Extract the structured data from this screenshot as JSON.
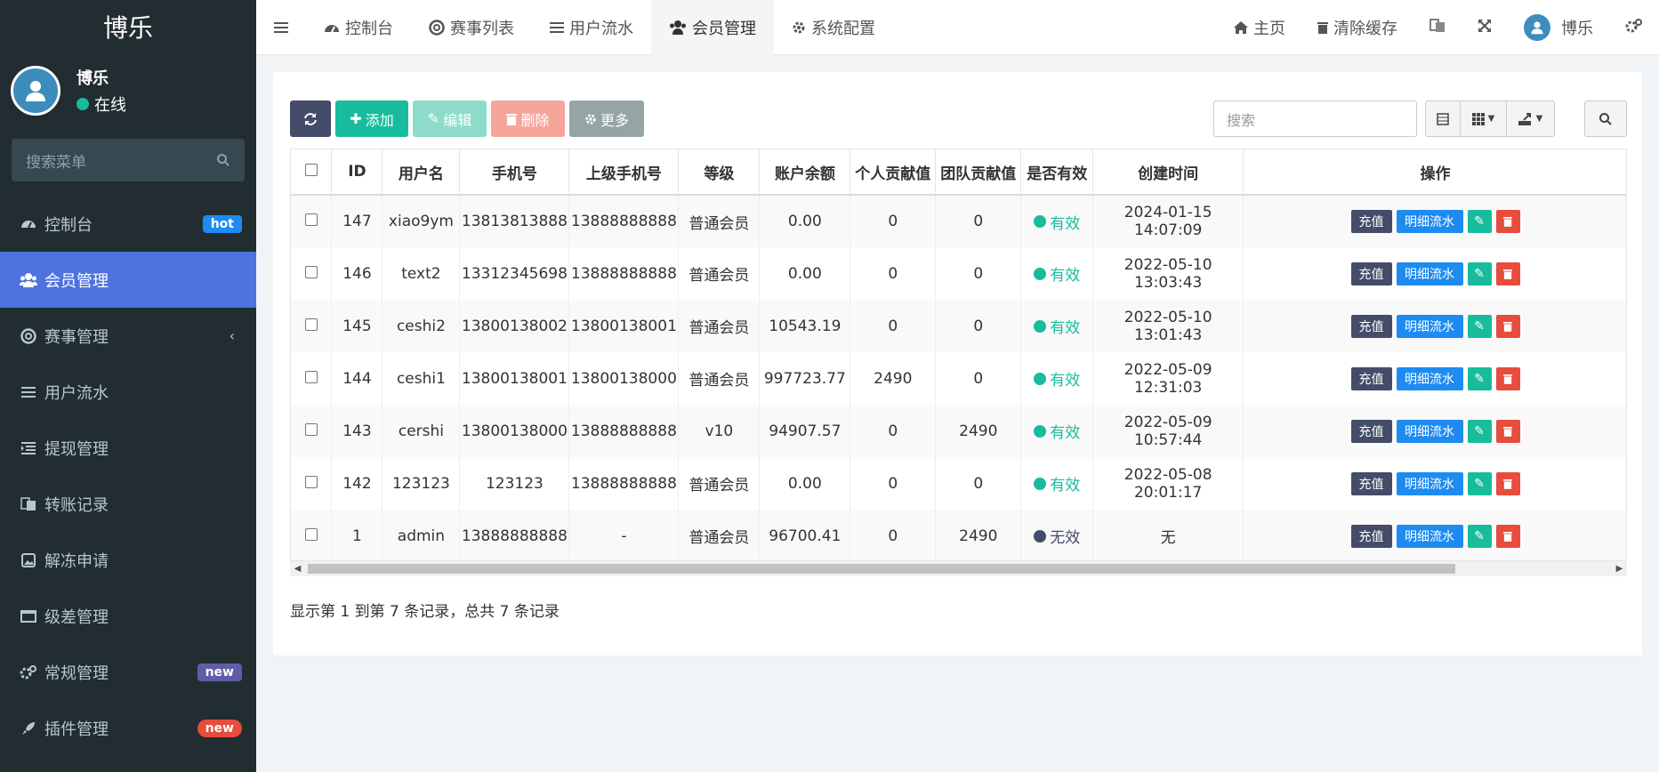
{
  "app": {
    "logo": "博乐",
    "user_name": "博乐",
    "status": "在线",
    "search_placeholder": "搜索菜单"
  },
  "sidebar": {
    "items": [
      {
        "label": "控制台",
        "icon": "dashboard-icon",
        "badge": "hot"
      },
      {
        "label": "会员管理",
        "icon": "users-icon"
      },
      {
        "label": "赛事管理",
        "icon": "lifebuoy-icon"
      },
      {
        "label": "用户流水",
        "icon": "list-icon"
      },
      {
        "label": "提现管理",
        "icon": "indent-icon"
      },
      {
        "label": "转账记录",
        "icon": "translate-icon"
      },
      {
        "label": "解冻申请",
        "icon": "image-icon"
      },
      {
        "label": "级差管理",
        "icon": "window-icon"
      },
      {
        "label": "常规管理",
        "icon": "cogs-icon",
        "badge": "new"
      },
      {
        "label": "插件管理",
        "icon": "rocket-icon",
        "badge": "new"
      }
    ]
  },
  "topnav": {
    "tabs": [
      {
        "label": "控制台",
        "icon": "dashboard-icon"
      },
      {
        "label": "赛事列表",
        "icon": "lifebuoy-icon"
      },
      {
        "label": "用户流水",
        "icon": "list-icon"
      },
      {
        "label": "会员管理",
        "icon": "users-icon"
      },
      {
        "label": "系统配置",
        "icon": "gear-icon"
      }
    ],
    "home": "主页",
    "clear_cache": "清除缓存",
    "user": "博乐"
  },
  "toolbar": {
    "add": "添加",
    "edit": "编辑",
    "delete": "删除",
    "more": "更多",
    "search_placeholder": "搜索"
  },
  "table": {
    "headers": [
      "ID",
      "用户名",
      "手机号",
      "上级手机号",
      "等级",
      "账户余额",
      "个人贡献值",
      "团队贡献值",
      "是否有效",
      "创建时间",
      "操作"
    ],
    "rows": [
      {
        "id": "147",
        "username": "xiao9ym",
        "phone": "13813813888",
        "parent_phone": "13888888888",
        "level": "普通会员",
        "balance": "0.00",
        "personal": "0",
        "team": "0",
        "status": "有效",
        "created": "2024-01-15 14:07:09"
      },
      {
        "id": "146",
        "username": "text2",
        "phone": "13312345698",
        "parent_phone": "13888888888",
        "level": "普通会员",
        "balance": "0.00",
        "personal": "0",
        "team": "0",
        "status": "有效",
        "created": "2022-05-10 13:03:43"
      },
      {
        "id": "145",
        "username": "ceshi2",
        "phone": "13800138002",
        "parent_phone": "13800138001",
        "level": "普通会员",
        "balance": "10543.19",
        "personal": "0",
        "team": "0",
        "status": "有效",
        "created": "2022-05-10 13:01:43"
      },
      {
        "id": "144",
        "username": "ceshi1",
        "phone": "13800138001",
        "parent_phone": "13800138000",
        "level": "普通会员",
        "balance": "997723.77",
        "personal": "2490",
        "team": "0",
        "status": "有效",
        "created": "2022-05-09 12:31:03"
      },
      {
        "id": "143",
        "username": "cershi",
        "phone": "13800138000",
        "parent_phone": "13888888888",
        "level": "v10",
        "balance": "94907.57",
        "personal": "0",
        "team": "2490",
        "status": "有效",
        "created": "2022-05-09 10:57:44"
      },
      {
        "id": "142",
        "username": "123123",
        "phone": "123123",
        "parent_phone": "13888888888",
        "level": "普通会员",
        "balance": "0.00",
        "personal": "0",
        "team": "0",
        "status": "有效",
        "created": "2022-05-08 20:01:17"
      },
      {
        "id": "1",
        "username": "admin",
        "phone": "13888888888",
        "parent_phone": "-",
        "level": "普通会员",
        "balance": "96700.41",
        "personal": "0",
        "team": "2490",
        "status": "无效",
        "created": "无"
      }
    ],
    "row_actions": {
      "charge": "充值",
      "flow": "明细流水"
    }
  },
  "pagination": {
    "summary": "显示第 1 到第 7 条记录，总共 7 条记录"
  },
  "colors": {
    "sidebar_bg": "#222d32",
    "active": "#4e73df",
    "success": "#18bc9c",
    "primary": "#1e8bf1",
    "danger": "#e74c3c",
    "dark": "#444c69"
  }
}
